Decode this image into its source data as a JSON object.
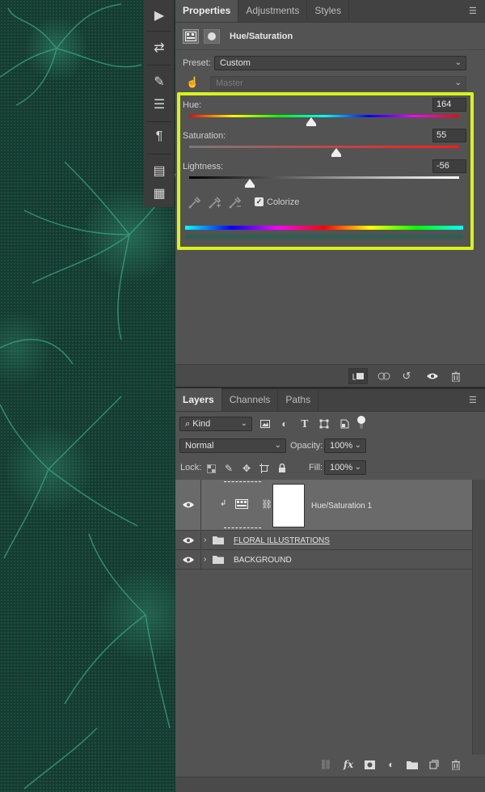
{
  "tools": [
    {
      "name": "play-icon",
      "glyph": "▶"
    },
    {
      "name": "swap-icon",
      "glyph": "⇄"
    },
    {
      "name": "brush-presets-icon",
      "glyph": "✎"
    },
    {
      "name": "adjustments-icon",
      "glyph": "☰"
    },
    {
      "name": "paragraph-icon",
      "glyph": "¶"
    },
    {
      "name": "notes-icon",
      "glyph": "▤"
    },
    {
      "name": "history-icon",
      "glyph": "▦"
    }
  ],
  "properties": {
    "tabs": [
      "Properties",
      "Adjustments",
      "Styles"
    ],
    "title": "Hue/Saturation",
    "preset_label": "Preset:",
    "preset_value": "Custom",
    "channel_value": "Master",
    "hue": {
      "label": "Hue:",
      "value": "164",
      "fraction": 0.453
    },
    "saturation": {
      "label": "Saturation:",
      "value": "55",
      "fraction": 0.545
    },
    "lightness": {
      "label": "Lightness:",
      "value": "-56",
      "fraction": 0.225
    },
    "colorize_label": "Colorize",
    "colorize_checked": true,
    "checkmark": "✓"
  },
  "layers_panel": {
    "tabs": [
      "Layers",
      "Channels",
      "Paths"
    ],
    "filter_kind": "Kind",
    "blend_mode": "Normal",
    "opacity_label": "Opacity:",
    "opacity_value": "100%",
    "lock_label": "Lock:",
    "fill_label": "Fill:",
    "fill_value": "100%",
    "layers": [
      {
        "name": "Hue/Saturation 1"
      },
      {
        "name": "FLORAL ILLUSTRATIONS"
      },
      {
        "name": "BACKGROUND"
      }
    ]
  },
  "colors": {
    "highlight": "#d8f31a",
    "canvas": "#163a31",
    "panel": "#535353"
  }
}
